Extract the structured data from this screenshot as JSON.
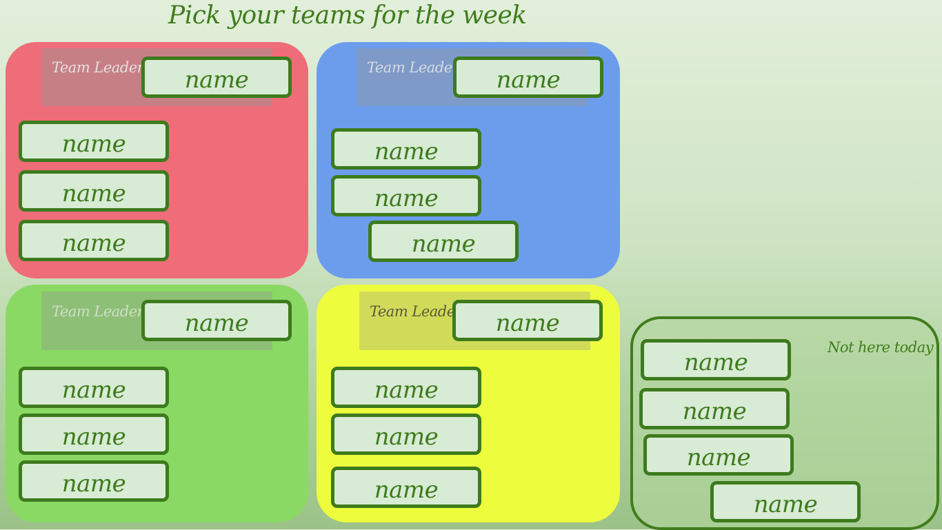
{
  "title": "Pick your teams for the week",
  "teams": {
    "red": {
      "color": "#ef6c79",
      "leader_label": "Team Leader",
      "leader_name": "name",
      "members": [
        "name",
        "name",
        "name"
      ]
    },
    "blue": {
      "color": "#6c9ded",
      "leader_label": "Team Leader",
      "leader_name": "name",
      "members": [
        "name",
        "name",
        "name"
      ]
    },
    "green": {
      "color": "#8ad964",
      "leader_label": "Team Leader",
      "leader_name": "name",
      "members": [
        "name",
        "name",
        "name"
      ]
    },
    "yellow": {
      "color": "#edfd3d",
      "leader_label": "Team Leader",
      "leader_name": "name",
      "members": [
        "name",
        "name",
        "name"
      ]
    }
  },
  "absent": {
    "label": "Not here today",
    "members": [
      "name",
      "name",
      "name",
      "name"
    ]
  },
  "colors": {
    "card_border": "#3d7b1d",
    "card_fill": "#d8ebd4",
    "text": "#3d7b1d"
  }
}
